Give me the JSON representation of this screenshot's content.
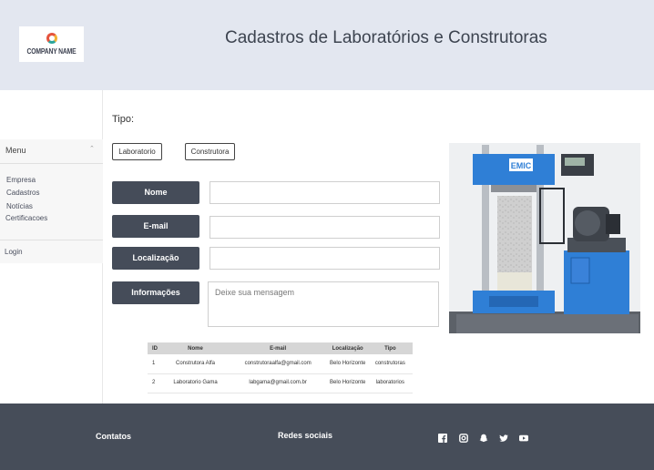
{
  "header": {
    "logo_text": "COMPANY NAME",
    "title": "Cadastros de Laboratórios e Construtoras"
  },
  "sidebar": {
    "menu_title": "Menu",
    "items": [
      {
        "label": "Empresa"
      },
      {
        "label": "Cadastros"
      },
      {
        "label": "Notícias"
      },
      {
        "label": "Certificacoes"
      }
    ],
    "login": "Login"
  },
  "form": {
    "tipo_label": "Tipo:",
    "type_buttons": [
      "Laboratorio",
      "Construtora"
    ],
    "fields": {
      "nome": {
        "label": "Nome",
        "value": ""
      },
      "email": {
        "label": "E-mail",
        "value": ""
      },
      "localizacao": {
        "label": "Localização",
        "value": ""
      },
      "informacoes": {
        "label": "Informações",
        "placeholder": "Deixe sua mensagem"
      }
    }
  },
  "image": {
    "brand": "EMIC"
  },
  "table": {
    "headers": [
      "ID",
      "Nome",
      "E-mail",
      "Localização",
      "Tipo"
    ],
    "rows": [
      [
        "1",
        "Construtora Alfa",
        "construtoraalfa@gmail.com",
        "Belo Horizonte",
        "construtoras"
      ],
      [
        "2",
        "Laboratorio Gama",
        "labgama@gmail.com.br",
        "Belo Horizonte",
        "laboratorios"
      ]
    ]
  },
  "footer": {
    "contacts": "Contatos",
    "social": "Redes sociais",
    "icons": [
      "facebook-icon",
      "instagram-icon",
      "snapchat-icon",
      "twitter-icon",
      "youtube-icon"
    ]
  }
}
